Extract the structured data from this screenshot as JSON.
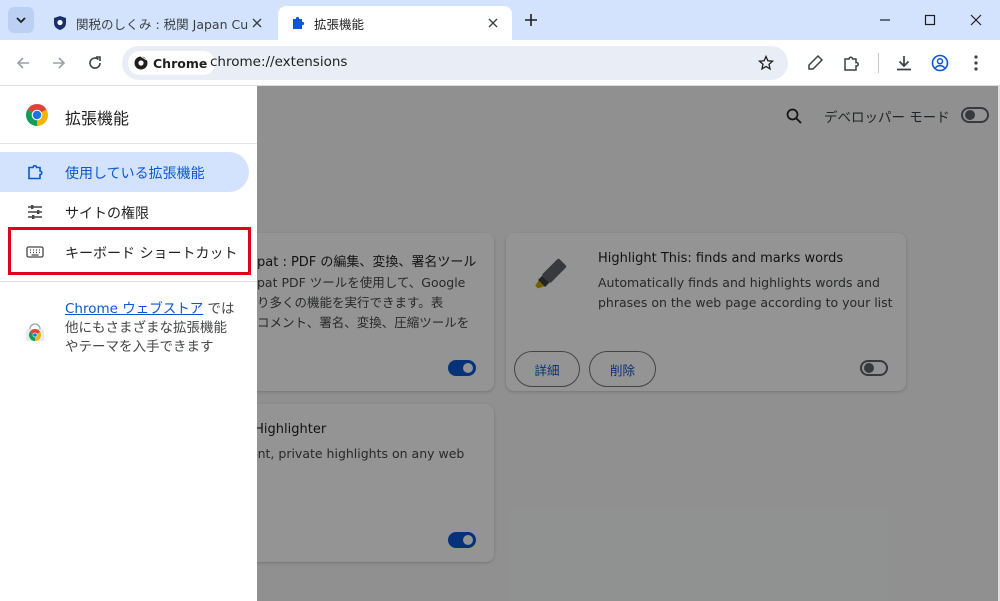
{
  "tabs": [
    {
      "title": "関税のしくみ : 税関 Japan Customs",
      "active": false
    },
    {
      "title": "拡張機能",
      "active": true
    }
  ],
  "toolbar": {
    "chip_label": "Chrome",
    "url": "chrome://extensions"
  },
  "header": {
    "dev_mode_label": "デベロッパー モード",
    "dev_mode_enabled": false
  },
  "cards": [
    {
      "name": "pat : PDF の編集、変換、署名ツール",
      "description": "pat PDF ツールを使用して、Google\nり多くの機能を実行できます。表\nコメント、署名、変換、圧縮ツールを",
      "enabled": true
    },
    {
      "name": "Highlight This: finds and marks words",
      "description": "Automatically finds and highlights words and\nphrases on the web page according to your list",
      "details_label": "詳細",
      "remove_label": "削除",
      "enabled": false
    },
    {
      "name": "e Highlighter",
      "description": "nent, private highlights on any web",
      "enabled": true
    }
  ],
  "drawer": {
    "title": "拡張機能",
    "items": [
      {
        "label": "使用している拡張機能",
        "selected": true,
        "icon": "puzzle-icon"
      },
      {
        "label": "サイトの権限",
        "selected": false,
        "icon": "tune-icon"
      },
      {
        "label": "キーボード ショートカット",
        "selected": false,
        "icon": "keyboard-icon"
      }
    ],
    "store_link": "Chrome ウェブストア",
    "store_text_1": " では",
    "store_text_2": "他にもさまざまな拡張機能",
    "store_text_3": "やテーマを入手できます"
  },
  "colors": {
    "accent": "#0b57d0",
    "selected_bg": "#d3e3fd",
    "highlight_box": "#e3001b"
  }
}
